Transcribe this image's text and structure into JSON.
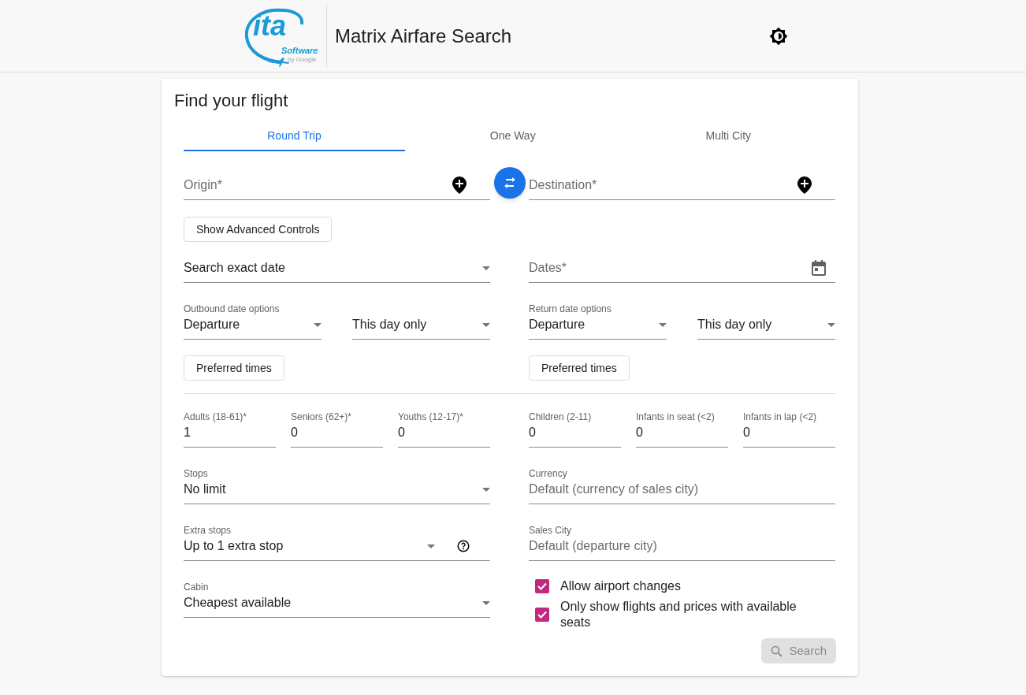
{
  "header": {
    "logo": {
      "mark": "ita",
      "brand": "Software",
      "by": "by Google"
    },
    "title": "Matrix Airfare Search"
  },
  "card": {
    "title": "Find your flight",
    "tabs": [
      {
        "label": "Round Trip",
        "selected": true
      },
      {
        "label": "One Way",
        "selected": false
      },
      {
        "label": "Multi City",
        "selected": false
      }
    ],
    "origin": {
      "placeholder": "Origin*"
    },
    "destination": {
      "placeholder": "Destination*"
    },
    "advanced_button": "Show Advanced Controls",
    "date_mode": {
      "value": "Search exact date"
    },
    "dates": {
      "placeholder": "Dates*"
    },
    "outbound": {
      "label": "Outbound date options",
      "value": "Departure",
      "range": "This day only",
      "button": "Preferred times"
    },
    "return": {
      "label": "Return date options",
      "value": "Departure",
      "range": "This day only",
      "button": "Preferred times"
    },
    "passengers": [
      {
        "label": "Adults (18-61)*",
        "value": "1"
      },
      {
        "label": "Seniors (62+)*",
        "value": "0"
      },
      {
        "label": "Youths (12-17)*",
        "value": "0"
      },
      {
        "label": "Children (2-11)",
        "value": "0"
      },
      {
        "label": "Infants in seat (<2)",
        "value": "0"
      },
      {
        "label": "Infants in lap (<2)",
        "value": "0"
      }
    ],
    "stops": {
      "label": "Stops",
      "value": "No limit"
    },
    "extra_stops": {
      "label": "Extra stops",
      "value": "Up to 1 extra stop"
    },
    "cabin": {
      "label": "Cabin",
      "value": "Cheapest available"
    },
    "currency": {
      "label": "Currency",
      "placeholder": "Default (currency of sales city)"
    },
    "sales_city": {
      "label": "Sales City",
      "placeholder": "Default (departure city)"
    },
    "checkboxes": [
      {
        "label": "Allow airport changes",
        "checked": true
      },
      {
        "label": "Only show flights and prices with available seats",
        "checked": true
      }
    ],
    "search": {
      "label": "Search",
      "disabled": true
    }
  }
}
